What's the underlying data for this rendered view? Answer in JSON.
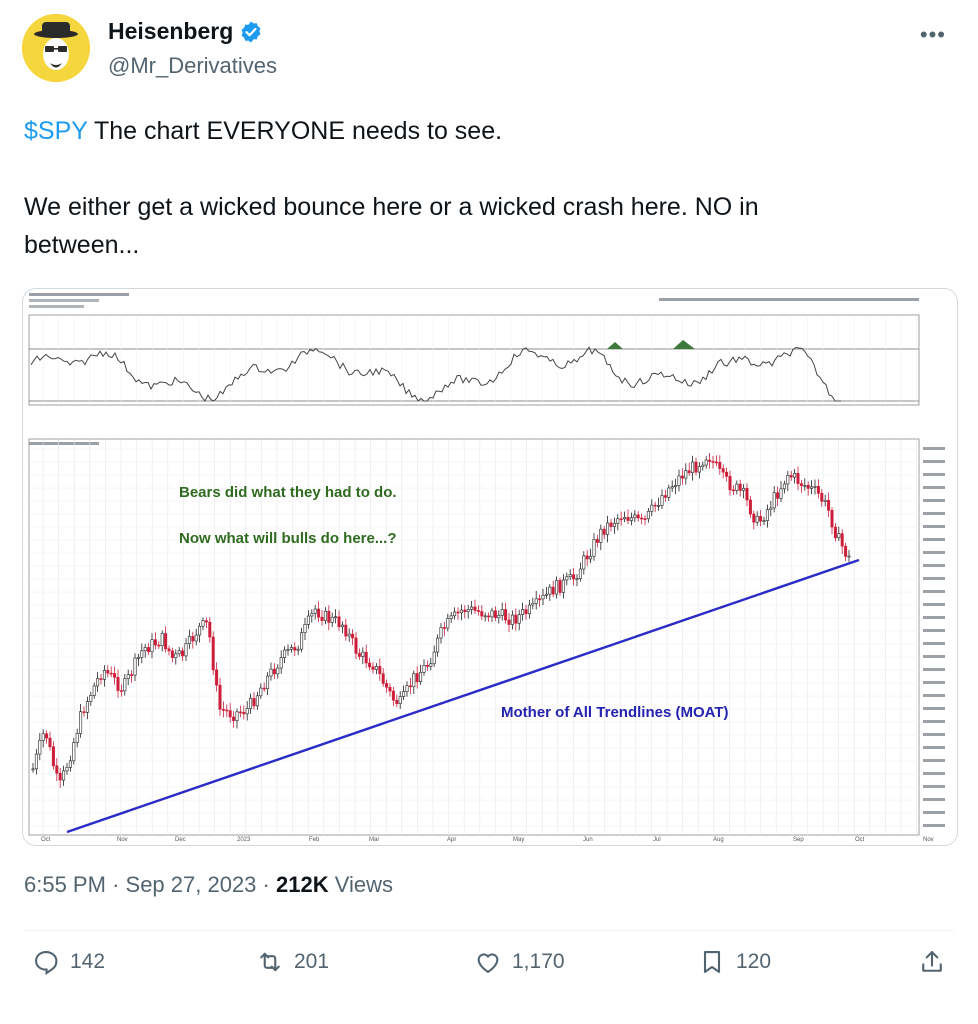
{
  "author": {
    "display_name": "Heisenberg",
    "handle": "@Mr_Derivatives",
    "verified": true,
    "avatar_icon": "heisenberg-avatar-icon"
  },
  "more_icon": "more-horizontal-icon",
  "tweet": {
    "cashtag": "$SPY",
    "line1_rest": " The chart EVERYONE needs to see.",
    "line2": "We either get a wicked bounce here or a wicked crash here. NO in between..."
  },
  "chart_data": {
    "type": "candlestick",
    "annotations": [
      "Bears did what they had to do.",
      "Now what will bulls do here...?",
      "Mother of All Trendlines (MOAT)"
    ],
    "x_tick_labels": [
      "Oct",
      "Nov",
      "Dec",
      "2023",
      "Feb",
      "Mar",
      "Apr",
      "May",
      "Jun",
      "Jul",
      "Aug",
      "Sep",
      "Oct",
      "Nov"
    ],
    "colors": {
      "up": "#222222",
      "down": "#cc1f3a",
      "trendline": "#2b2bc8",
      "annotation_green": "#2f6b1f",
      "annotation_blue": "#2323b0"
    }
  },
  "meta": {
    "time": "6:55 PM",
    "date": "Sep 27, 2023",
    "views_count": "212K",
    "views_label": " Views"
  },
  "actions": {
    "replies": "142",
    "reposts": "201",
    "likes": "1,170",
    "bookmarks": "120"
  },
  "colors": {
    "accent": "#1d9bf0",
    "secondary_text": "#536471"
  }
}
